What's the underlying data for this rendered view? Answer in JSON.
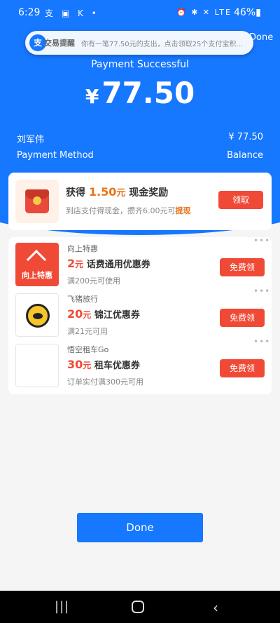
{
  "status_bar": {
    "time": "6:29",
    "left_icons": "支 ▣ K •",
    "right_icons": "⏰ ✱ ✕ LTE",
    "battery": "46%▮"
  },
  "notification": {
    "app_icon": "支",
    "title": "交易提醒",
    "text": "你有一笔77.50元的支出，点击领取25个支付宝积..."
  },
  "header": {
    "done_label": "Done",
    "title": "Payment Successful",
    "currency": "¥",
    "amount": "77.50"
  },
  "details": {
    "payee_label": "刘军伟",
    "payee_amount": "¥ 77.50",
    "method_label": "Payment Method",
    "method_value": "Balance"
  },
  "reward": {
    "title_prefix": "获得",
    "amount": "1.50",
    "unit": "元",
    "title_suffix": "现金奖励",
    "subtitle": "到店支付得现金，攒齐6.00元可",
    "subtitle_link": "提现",
    "button": "领取"
  },
  "coupons": [
    {
      "brand": "向上特惠",
      "logo_text": "向上特惠",
      "value": "2",
      "unit": "元",
      "name": "话费通用优惠券",
      "condition": "满200元可使用",
      "button": "免费领",
      "more": "•••"
    },
    {
      "brand": "飞猪旅行",
      "value": "20",
      "unit": "元",
      "name": "锦江优惠券",
      "condition": "满21元可用",
      "button": "免费领",
      "more": "•••"
    },
    {
      "brand": "悟空租车Go",
      "value": "30",
      "unit": "元",
      "name": "租车优惠券",
      "condition": "订单实付满300元可用",
      "button": "免费领",
      "more": "•••"
    }
  ],
  "footer": {
    "done_label": "Done"
  },
  "nav": {
    "recent": "|||",
    "back": "‹"
  },
  "colors": {
    "primary": "#1677ff",
    "accent_red": "#f04a37",
    "accent_orange": "#e8741a"
  }
}
